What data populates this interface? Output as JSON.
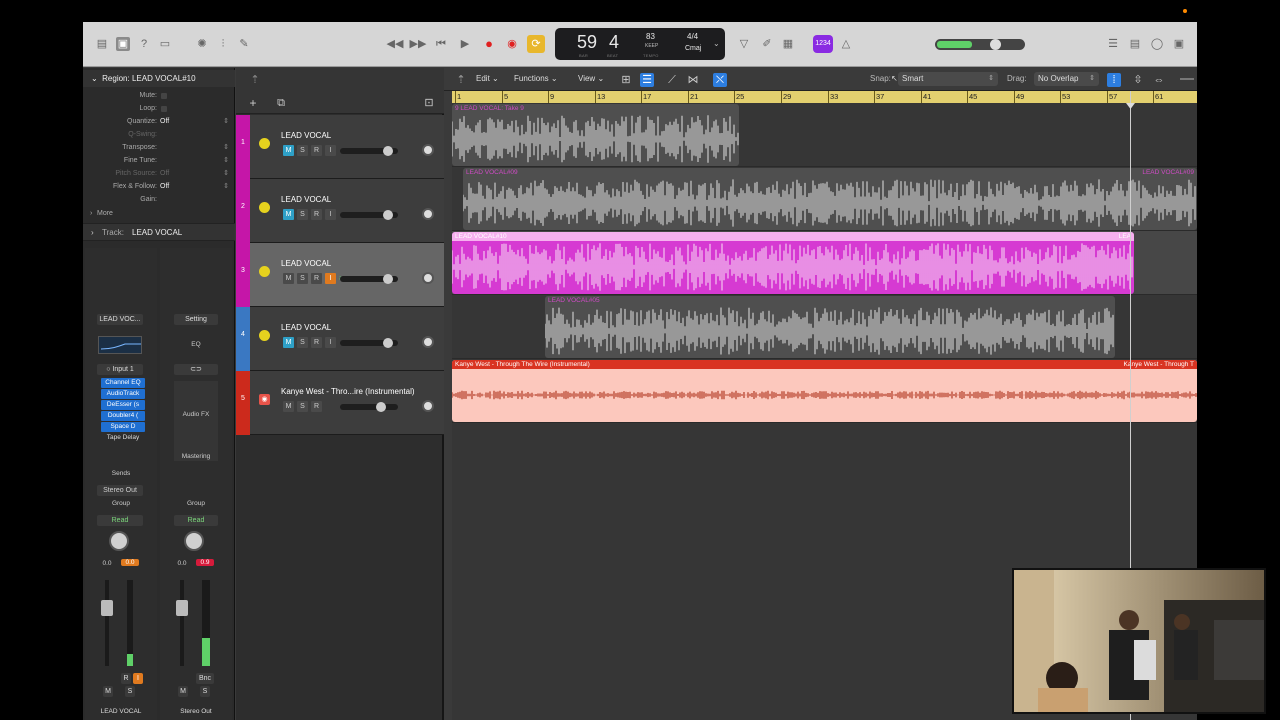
{
  "toolbar": {
    "left_icons": [
      "library-icon",
      "inspector-icon",
      "help-icon",
      "toolbar-icon",
      "smart-controls-icon",
      "mixer-icon",
      "editors-icon"
    ],
    "transport": {
      "rewind": "rewind-icon",
      "forward": "fast-forward-icon",
      "to_start": "go-to-start-icon",
      "play": "play-icon",
      "record": "record-icon",
      "capture": "capture-record-icon",
      "cycle": "cycle-icon"
    },
    "lcd": {
      "bar": "59",
      "beat": "4",
      "bar_label": "BAR",
      "beat_label": "BEAT",
      "tempo": "83",
      "keep": "KEEP",
      "tempo_label": "TEMPO",
      "signature": "4/4",
      "key": "Cmaj"
    },
    "right_icons": [
      "tuner-icon",
      "pencil-icon",
      "list-icon"
    ],
    "count_in": "1234",
    "master_volume": 0.7
  },
  "inspector": {
    "region_header": "Region: LEAD VOCAL#10",
    "rows": [
      {
        "k": "Mute:",
        "v": "",
        "type": "check"
      },
      {
        "k": "Loop:",
        "v": "",
        "type": "check"
      },
      {
        "k": "Quantize:",
        "v": "Off",
        "type": "sel"
      },
      {
        "k": "Q-Swing:",
        "v": "",
        "type": "dim"
      },
      {
        "k": "Transpose:",
        "v": "",
        "type": "sel"
      },
      {
        "k": "Fine Tune:",
        "v": "",
        "type": "sel"
      },
      {
        "k": "Pitch Source:",
        "v": "Off",
        "type": "dimsel"
      },
      {
        "k": "Flex & Follow:",
        "v": "Off",
        "type": "sel"
      },
      {
        "k": "Gain:",
        "v": "",
        "type": "none"
      }
    ],
    "more": "More",
    "track_label": "Track:",
    "track_value": "LEAD VOCAL",
    "strip1": {
      "name_btn": "LEAD VOC...",
      "input": "Input 1",
      "plugins": [
        "Channel EQ",
        "AudioTrack",
        "DeEsser (s",
        "Doubler4 (",
        "Space D",
        "Tape Delay"
      ],
      "sends": "Sends",
      "output": "Stereo Out",
      "group": "Group",
      "auto": "Read",
      "vol": "0.0",
      "pk": "0.0",
      "r": "R",
      "i": "I",
      "m": "M",
      "s": "S",
      "name": "LEAD VOCAL"
    },
    "strip2": {
      "setting": "Setting",
      "eq": "EQ",
      "audio_fx": "Audio FX",
      "mastering": "Mastering",
      "group": "Group",
      "auto": "Read",
      "vol": "0.0",
      "pk": "0.9",
      "bnc": "Bnc",
      "m": "M",
      "s": "S",
      "name": "Stereo Out"
    }
  },
  "menubar": {
    "edit": "Edit",
    "functions": "Functions",
    "view": "View",
    "snap_label": "Snap:",
    "snap_value": "Smart",
    "drag_label": "Drag:",
    "drag_value": "No Overlap"
  },
  "tracks": [
    {
      "num": "1",
      "name": "LEAD VOCAL",
      "color": "#c516a8",
      "icon": "microphone-icon",
      "m": "M",
      "s": "S",
      "r": "R",
      "i": "I",
      "vol": 0.9
    },
    {
      "num": "2",
      "name": "LEAD VOCAL",
      "color": "#c516a8",
      "icon": "microphone-icon",
      "m": "M",
      "s": "S",
      "r": "R",
      "i": "I",
      "vol": 0.9
    },
    {
      "num": "3",
      "name": "LEAD VOCAL",
      "color": "#c516a8",
      "icon": "microphone-icon",
      "m": "M",
      "s": "S",
      "r": "R",
      "i": "I",
      "vol": 0.9
    },
    {
      "num": "4",
      "name": "LEAD VOCAL",
      "color": "#3a78c2",
      "icon": "microphone-icon",
      "m": "M",
      "s": "S",
      "r": "R",
      "i": "I",
      "vol": 0.9
    },
    {
      "num": "5",
      "name": "Kanye West - Thro...ire (Instrumental)",
      "color": "#cc2a1c",
      "icon": "waveform-icon",
      "m": "M",
      "s": "S",
      "r": "R",
      "vol": 0.75
    }
  ],
  "ruler": [
    "1",
    "5",
    "9",
    "13",
    "17",
    "21",
    "25",
    "29",
    "33",
    "37",
    "41",
    "45",
    "49",
    "53",
    "57",
    "61"
  ],
  "regions": [
    {
      "lane": 0,
      "title": "9   LEAD VOCAL: Take 9",
      "start": 0.0,
      "end": 0.385,
      "bg": "#4f4f4f",
      "wave": "#c9c9c9",
      "tc": "#d04bc6"
    },
    {
      "lane": 1,
      "title": "LEAD VOCAL#09",
      "start": 0.015,
      "end": 1.0,
      "bg": "#4f4f4f",
      "wave": "#c9c9c9",
      "tc": "#d04bc6",
      "title2": "LEAD VOCAL#09"
    },
    {
      "lane": 2,
      "title": "LEAD VOCAL#10",
      "start": 0.0,
      "end": 0.915,
      "bg": "#d63ad2",
      "wave": "#f3c6ef",
      "tc": "#ffffff",
      "title2": "LEA",
      "head": "#f6b0ef"
    },
    {
      "lane": 3,
      "title": "LEAD VOCAL#05",
      "start": 0.125,
      "end": 0.89,
      "bg": "#4f4f4f",
      "wave": "#c9c9c9",
      "tc": "#d04bc6"
    },
    {
      "lane": 4,
      "title": "Kanye West - Through The Wire (Instrumental)",
      "start": 0.0,
      "end": 1.0,
      "bg": "#fcc8bd",
      "wave": "#b33a24",
      "tc": "#ffffff",
      "title2": "Kanye West - Through T",
      "head": "#d93422"
    }
  ],
  "playhead": 0.91
}
